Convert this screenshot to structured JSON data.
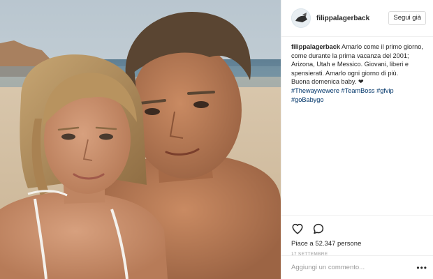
{
  "post": {
    "username": "filippalagerback",
    "follow_label": "Segui già",
    "caption": {
      "username": "filippalagerback",
      "text": "Amarlo come il primo giorno, come durante la prima vacanza del 2001; Arizona, Utah e Messico. Giovani, liberi e spensierati. Amarlo ogni giorno di più.",
      "line2": "Buona domenica baby.",
      "heart": "❤",
      "hashtags": [
        "#Thewaywewere",
        "#TeamBoss",
        "#gfvip",
        "#goBabygo"
      ]
    },
    "likes": "Piace a 52.347 persone",
    "date": "17 SETTEMBRE",
    "comment_placeholder": "Aggiungi un commento...",
    "more_label": "•••"
  },
  "icons": {
    "like": "heart-outline-icon",
    "comment": "speech-bubble-icon",
    "more": "ellipsis-icon"
  },
  "colors": {
    "text": "#262626",
    "hashtag": "#003569",
    "muted": "#999999",
    "border": "#efefef"
  }
}
